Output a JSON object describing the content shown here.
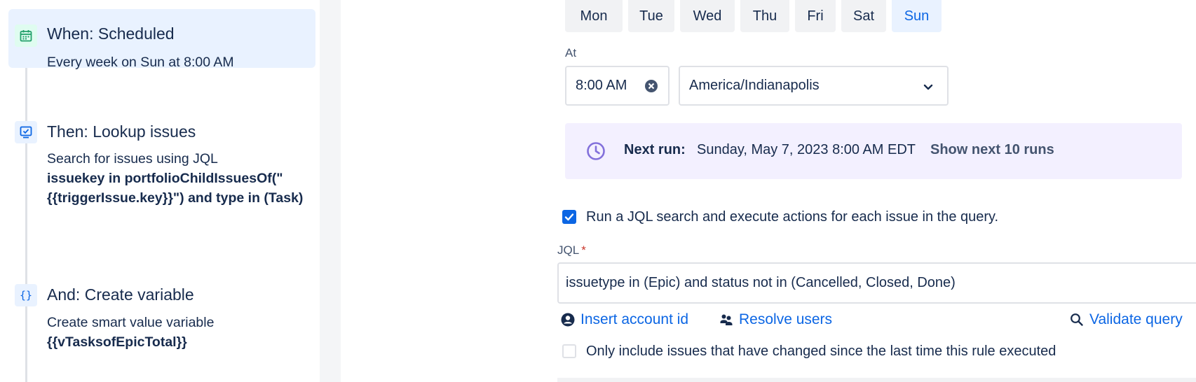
{
  "rule_steps": [
    {
      "icon": "calendar-icon",
      "title": "When: Scheduled",
      "description": "Every week on Sun at 8:00 AM",
      "selected": true
    },
    {
      "icon": "lookup-issues-icon",
      "title": "Then: Lookup issues",
      "description": "Search for issues using JQL",
      "description_bold": "issuekey in portfolioChildIssuesOf(\" {{triggerIssue.key}}\") and type in (Task)"
    },
    {
      "icon": "braces-icon",
      "title": "And: Create variable",
      "description": "Create smart value variable",
      "description_bold": "{{vTasksofEpicTotal}}"
    }
  ],
  "schedule": {
    "days": [
      {
        "label": "Mon",
        "active": false
      },
      {
        "label": "Tue",
        "active": false
      },
      {
        "label": "Wed",
        "active": false
      },
      {
        "label": "Thu",
        "active": false
      },
      {
        "label": "Fri",
        "active": false
      },
      {
        "label": "Sat",
        "active": false
      },
      {
        "label": "Sun",
        "active": true
      }
    ],
    "at_label": "At",
    "time_value": "8:00 AM",
    "timezone_value": "America/Indianapolis",
    "next_run_label": "Next run:",
    "next_run_value": "Sunday, May 7, 2023 8:00 AM EDT",
    "show_next_runs": "Show next 10 runs"
  },
  "jql": {
    "run_jql_checkbox_label": "Run a JQL search and execute actions for each issue in the query.",
    "run_jql_checked": true,
    "label": "JQL",
    "required_marker": "*",
    "value": "issuetype in (Epic) and status not in (Cancelled, Closed, Done)",
    "insert_account_id": "Insert account id",
    "resolve_users": "Resolve users",
    "validate_query": "Validate query",
    "only_changed_label": "Only include issues that have changed since the last time this rule executed",
    "only_changed_checked": false
  },
  "colors": {
    "accent": "#0c66e4",
    "selected_card_bg": "#e9f2ff",
    "next_run_bg": "#f3f0ff",
    "clock_icon": "#8270db",
    "calendar_icon": "#22a06b"
  }
}
